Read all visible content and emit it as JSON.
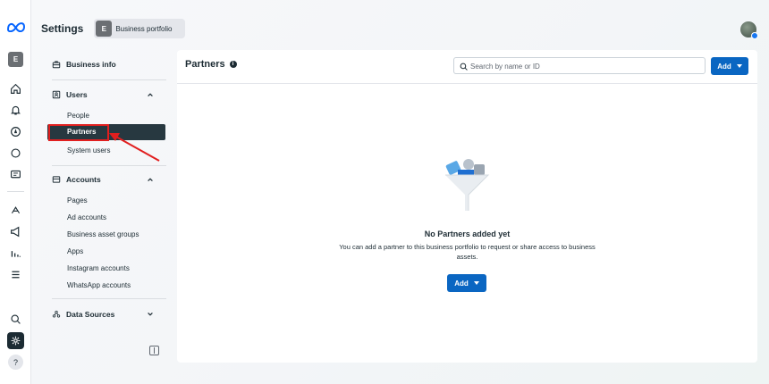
{
  "rail": {
    "account_initial": "E",
    "icons": [
      "meta-logo",
      "home-icon",
      "bell-icon",
      "compass-icon",
      "chat-icon",
      "pages-icon",
      "ads-icon",
      "megaphone-icon",
      "insights-icon",
      "menu-icon",
      "search-icon",
      "gear-icon",
      "help-icon"
    ],
    "help_label": "?"
  },
  "topbar": {
    "title": "Settings",
    "portfolio_initial": "E",
    "portfolio_label": "Business portfolio"
  },
  "sidebar": {
    "business_info": "Business info",
    "users": {
      "label": "Users",
      "items": [
        "People",
        "Partners",
        "System users"
      ],
      "active": "Partners"
    },
    "accounts": {
      "label": "Accounts",
      "items": [
        "Pages",
        "Ad accounts",
        "Business asset groups",
        "Apps",
        "Instagram accounts",
        "WhatsApp accounts"
      ]
    },
    "data_sources": {
      "label": "Data Sources"
    }
  },
  "content": {
    "title": "Partners",
    "search_placeholder": "Search by name or ID",
    "add_label": "Add",
    "empty_title": "No Partners added yet",
    "empty_desc": "You can add a partner to this business portfolio to request or share access to business assets.",
    "empty_add_label": "Add"
  },
  "colors": {
    "primary": "#0a66c2",
    "active_nav": "#273840",
    "annotation": "#e11f1f"
  }
}
